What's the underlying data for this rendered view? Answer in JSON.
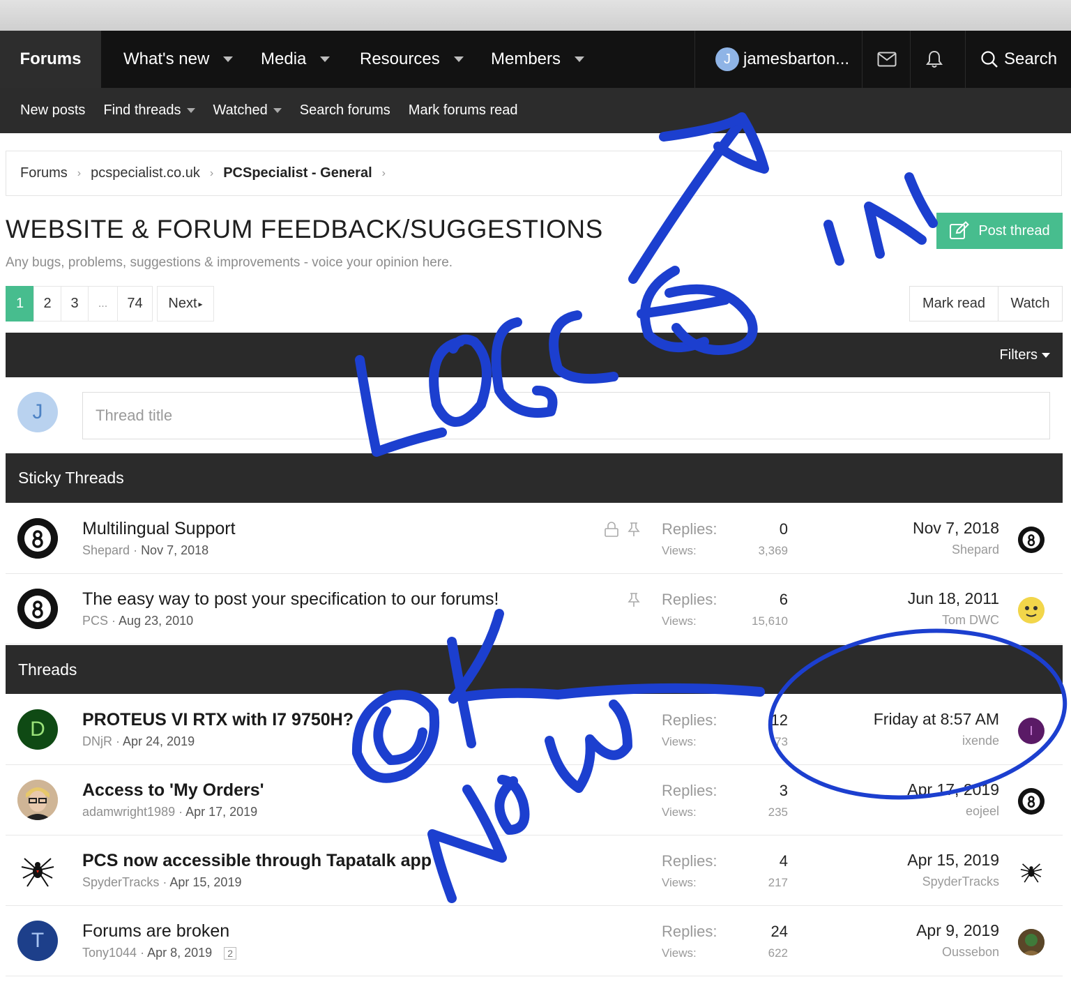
{
  "nav": {
    "tabs": [
      {
        "label": "Forums"
      },
      {
        "label": "What's new"
      },
      {
        "label": "Media"
      },
      {
        "label": "Resources"
      },
      {
        "label": "Members"
      }
    ],
    "user": {
      "initial": "J",
      "name": "jamesbarton..."
    },
    "search_label": "Search"
  },
  "subnav": {
    "items": [
      {
        "label": "New posts"
      },
      {
        "label": "Find threads"
      },
      {
        "label": "Watched"
      },
      {
        "label": "Search forums"
      },
      {
        "label": "Mark forums read"
      }
    ]
  },
  "breadcrumb": [
    "Forums",
    "pcspecialist.co.uk",
    "PCSpecialist - General"
  ],
  "page": {
    "title": "WEBSITE & FORUM FEEDBACK/SUGGESTIONS",
    "description": "Any bugs, problems, suggestions & improvements - voice your opinion here.",
    "post_thread_label": "Post thread"
  },
  "pagination": {
    "pages": [
      "1",
      "2",
      "3",
      "...",
      "74"
    ],
    "next_label": "Next"
  },
  "actions": {
    "mark_read": "Mark read",
    "watch": "Watch"
  },
  "filters_label": "Filters",
  "quick_thread": {
    "avatar_initial": "J",
    "placeholder": "Thread title"
  },
  "sections": {
    "sticky": "Sticky Threads",
    "threads": "Threads"
  },
  "labels": {
    "replies": "Replies:",
    "views": "Views:"
  },
  "sticky_threads": [
    {
      "title": "Multilingual Support",
      "author": "Shepard",
      "date": "Nov 7, 2018",
      "replies": "0",
      "views": "3,369",
      "last_date": "Nov 7, 2018",
      "last_user": "Shepard"
    },
    {
      "title": "The easy way to post your specification to our forums!",
      "author": "PCS",
      "date": "Aug 23, 2010",
      "replies": "6",
      "views": "15,610",
      "last_date": "Jun 18, 2011",
      "last_user": "Tom DWC"
    }
  ],
  "threads": [
    {
      "title": "PROTEUS VI RTX with I7 9750H?",
      "author": "DNjR",
      "date": "Apr 24, 2019",
      "avatar_initial": "D",
      "replies": "12",
      "views": "73",
      "last_date": "Friday at 8:57 AM",
      "last_user": "ixende",
      "last_initial": "I"
    },
    {
      "title": "Access to 'My Orders'",
      "author": "adamwright1989",
      "date": "Apr 17, 2019",
      "replies": "3",
      "views": "235",
      "last_date": "Apr 17, 2019",
      "last_user": "eojeel"
    },
    {
      "title": "PCS now accessible through Tapatalk app",
      "author": "SpyderTracks",
      "date": "Apr 15, 2019",
      "replies": "4",
      "views": "217",
      "last_date": "Apr 15, 2019",
      "last_user": "SpyderTracks"
    },
    {
      "title": "Forums are broken",
      "author": "Tony1044",
      "date": "Apr 8, 2019",
      "avatar_initial": "T",
      "page_badge": "2",
      "replies": "24",
      "views": "622",
      "last_date": "Apr 9, 2019",
      "last_user": "Oussebon"
    }
  ],
  "annotations": {
    "logged_in": "LOGGED IN",
    "ok_now": "OK NOW"
  },
  "colors": {
    "accent": "#47bd8e",
    "navbar": "#121212",
    "subnav": "#2c2c2c",
    "ink": "#1c3fcf"
  }
}
